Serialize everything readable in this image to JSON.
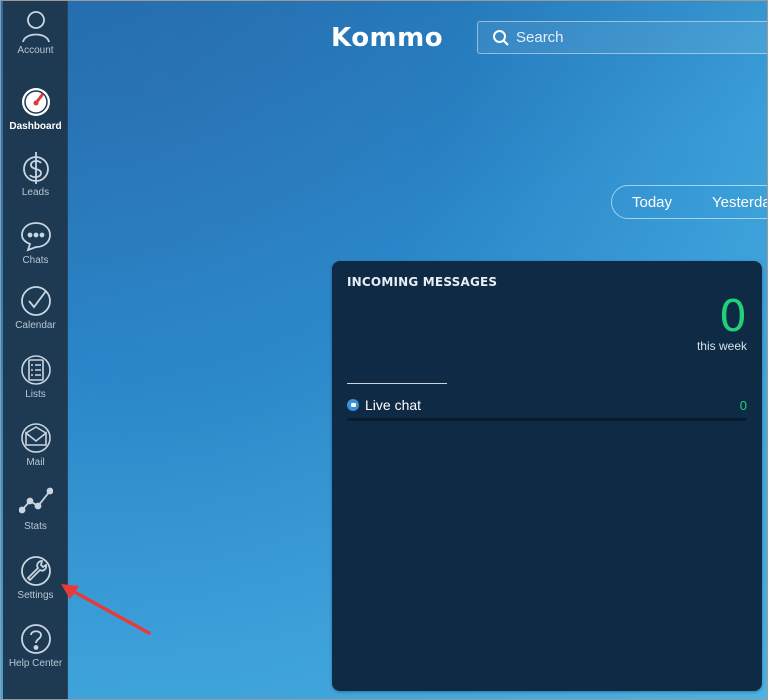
{
  "sidebar": {
    "items": [
      {
        "label": "Account",
        "icon": "account-icon"
      },
      {
        "label": "Dashboard",
        "icon": "dashboard-icon",
        "active": true
      },
      {
        "label": "Leads",
        "icon": "dollar-icon"
      },
      {
        "label": "Chats",
        "icon": "chat-bubble-icon"
      },
      {
        "label": "Calendar",
        "icon": "checkmark-circle-icon"
      },
      {
        "label": "Lists",
        "icon": "list-icon"
      },
      {
        "label": "Mail",
        "icon": "mail-icon"
      },
      {
        "label": "Stats",
        "icon": "stats-icon"
      },
      {
        "label": "Settings",
        "icon": "wrench-icon"
      },
      {
        "label": "Help Center",
        "icon": "question-icon"
      }
    ]
  },
  "header": {
    "logo": "Kommo",
    "search_placeholder": "Search"
  },
  "periods": [
    "Today",
    "Yesterday"
  ],
  "widget": {
    "title": "INCOMING MESSAGES",
    "count": "0",
    "count_label": "this week",
    "rows": [
      {
        "name": "Live chat",
        "value": "0"
      }
    ]
  },
  "colors": {
    "sidebar_bg": "#1d3a52",
    "card_bg": "#0f2a45",
    "accent_green": "#20d07a",
    "arrow_red": "#e8393b"
  }
}
